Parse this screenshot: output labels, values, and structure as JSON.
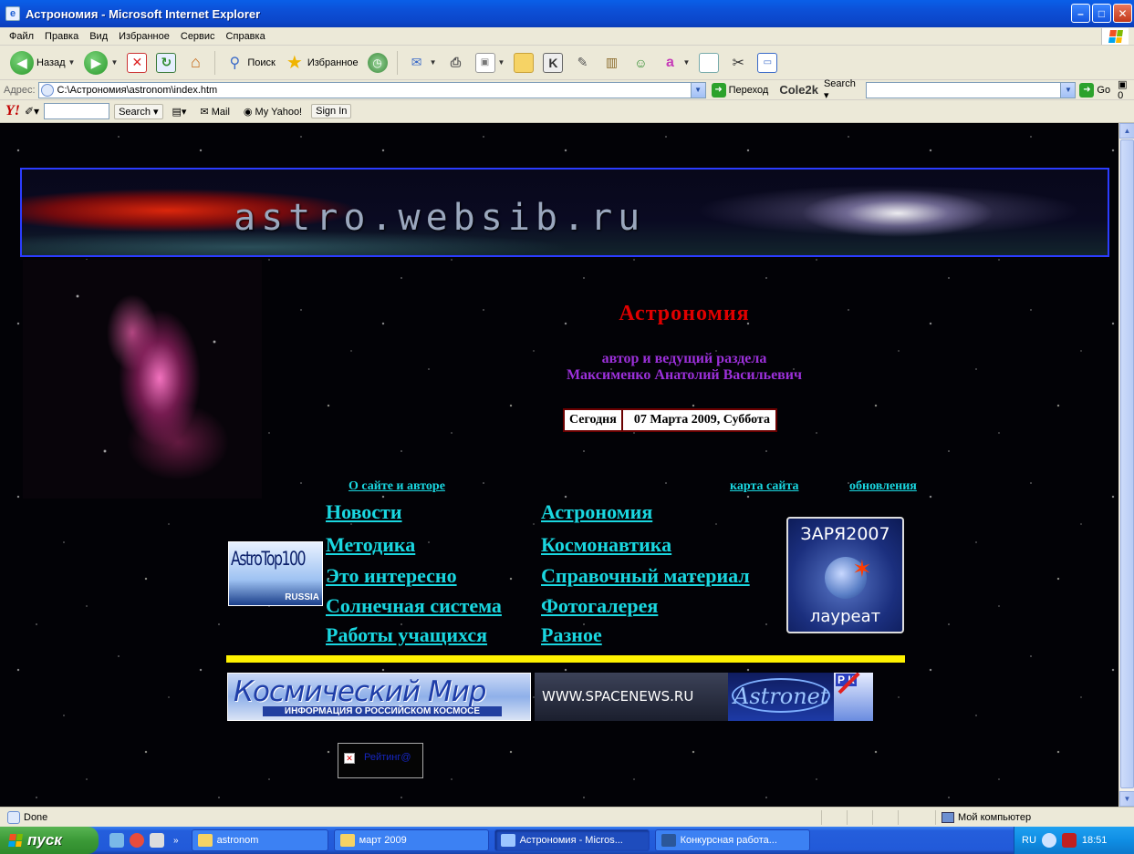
{
  "window": {
    "title": "Астрономия - Microsoft Internet Explorer",
    "controls": [
      "minimize",
      "maximize",
      "close"
    ]
  },
  "menu": [
    "Файл",
    "Правка",
    "Вид",
    "Избранное",
    "Сервис",
    "Справка"
  ],
  "toolbar": {
    "back_label": "Назад",
    "search_label": "Поиск",
    "favorites_label": "Избранное"
  },
  "address": {
    "label": "Адрес:",
    "url": "C:\\Астрономия\\astronom\\index.htm",
    "go_label": "Переход",
    "cole_label": "Cole2k",
    "cole_search_label": "Search",
    "go2_label": "Go",
    "counter": "0"
  },
  "yahoo": {
    "logo": "Y!",
    "search_label": "Search",
    "mail_label": "Mail",
    "myyahoo_label": "My Yahoo!",
    "signin_label": "Sign In"
  },
  "page": {
    "banner_text": "astro.websib.ru",
    "heading": "Астрономия",
    "author_line1": "автор и ведущий раздела",
    "author_line2": "Максименко Анатолий Васильевич",
    "date_label": "Сегодня",
    "date_value": "07 Марта 2009, Суббота",
    "top_links": {
      "about": "О сайте и авторе",
      "sitemap": "карта сайта",
      "updates": "обновления"
    },
    "nav_left": [
      "Новости",
      "Методика",
      "Это интересно",
      "Солнечная система",
      "Работы учащихся"
    ],
    "nav_right": [
      "Астрономия",
      "Космонавтика",
      "Справочный материал",
      "Фотогалерея",
      "Разное"
    ],
    "astrotop": {
      "text": "AstroTop100",
      "sub": "RUSSIA"
    },
    "zarya": {
      "top": "ЗАРЯ2007",
      "bottom": "лауреат"
    },
    "banners": {
      "kosmos_title": "Космический Мир",
      "kosmos_sub": "ИНФОРМАЦИЯ О РОССИЙСКОМ КОСМОСЕ",
      "spacenews": "WWW.SPACENEWS.RU",
      "astronet": "Astronet",
      "rk": "Р К"
    },
    "counter_text": "Рейтинг@"
  },
  "status": {
    "text": "Done",
    "zone": "Мой компьютер"
  },
  "taskbar": {
    "start_label": "пуск",
    "tasks": [
      "astronom",
      "март 2009",
      "Астрономия - Micros...",
      "Конкурсная работа..."
    ],
    "lang": "RU",
    "time": "18:51"
  },
  "colors": {
    "heading": "#e00000",
    "author": "#9b30d9",
    "link": "#1ad7e0",
    "yellow_rule": "#fff200"
  }
}
